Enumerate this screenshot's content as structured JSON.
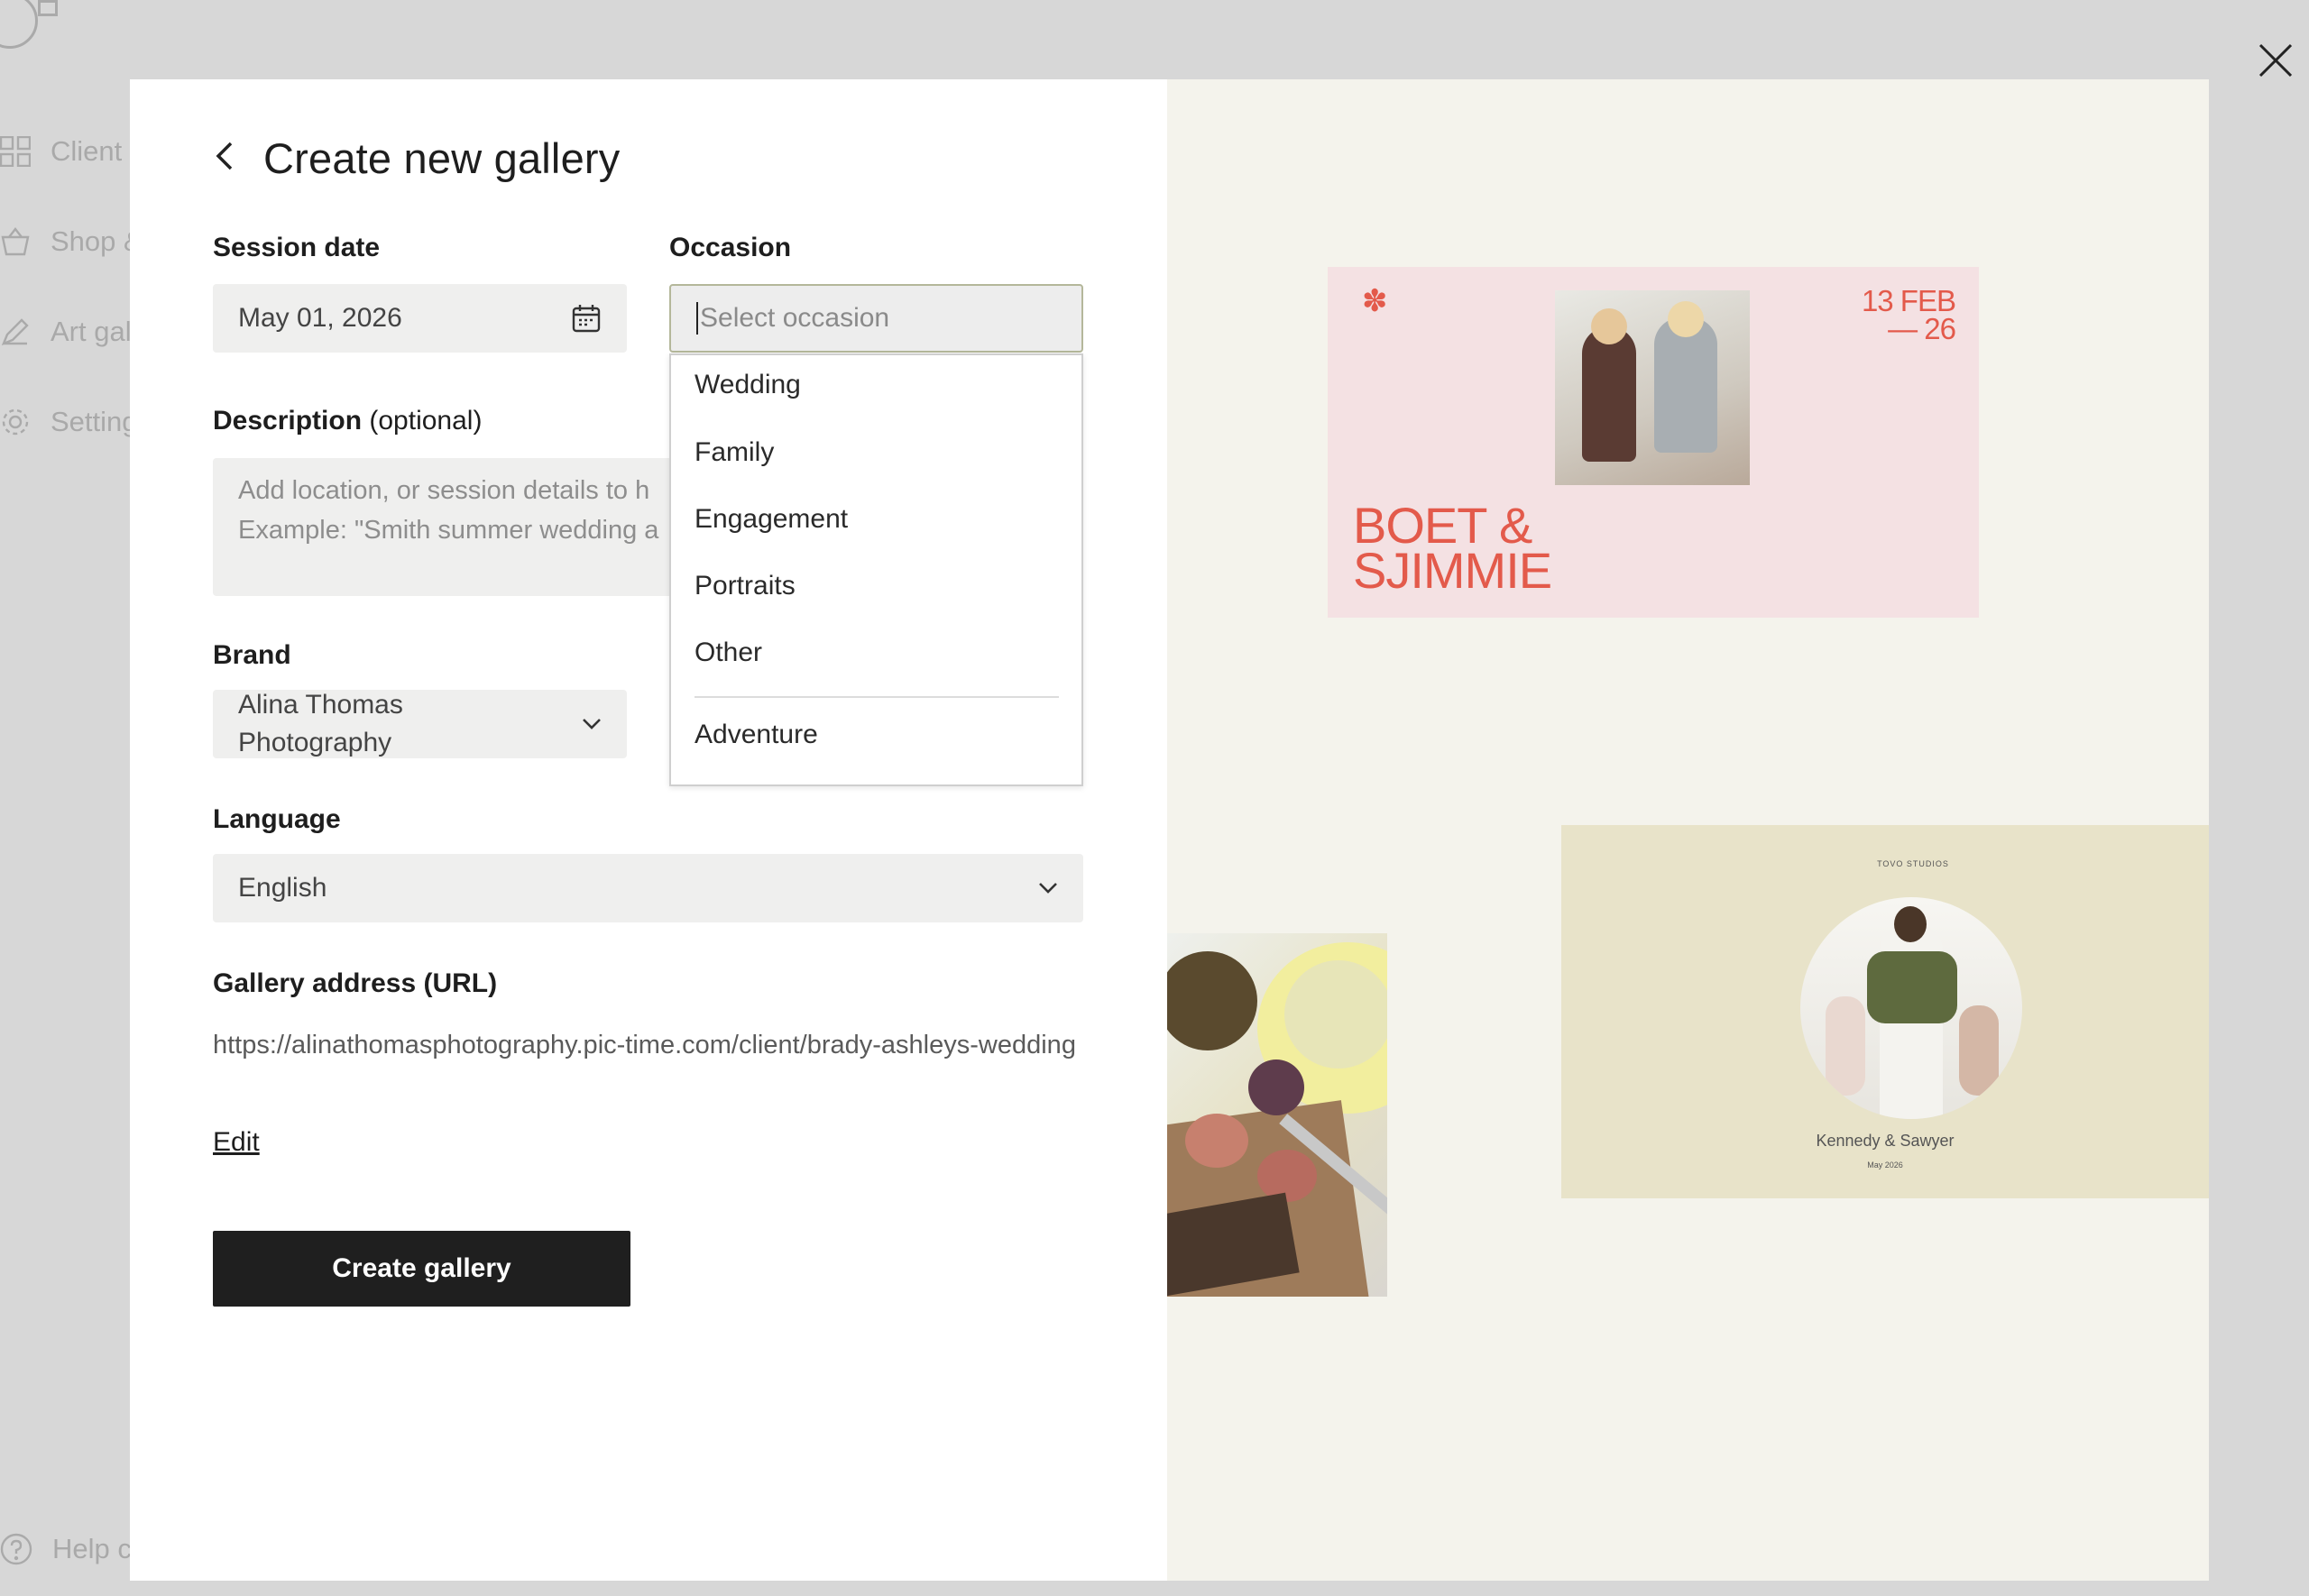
{
  "background": {
    "sidebar": {
      "items": [
        {
          "label": "Client",
          "icon": "grid-icon"
        },
        {
          "label": "Shop &",
          "icon": "basket-icon"
        },
        {
          "label": "Art gal",
          "icon": "pen-icon"
        },
        {
          "label": "Setting",
          "icon": "gear-icon"
        }
      ],
      "help_label": "Help c"
    }
  },
  "modal": {
    "title": "Create new gallery",
    "session_date": {
      "label": "Session date",
      "value": "May 01, 2026"
    },
    "occasion": {
      "label": "Occasion",
      "placeholder": "Select occasion",
      "options": [
        "Wedding",
        "Family",
        "Engagement",
        "Portraits",
        "Other"
      ],
      "extra_options": [
        "Adventure"
      ]
    },
    "description": {
      "label": "Description",
      "optional": "(optional)",
      "placeholder_line1": "Add location, or session details to h",
      "placeholder_line2": "Example: \"Smith summer wedding a"
    },
    "brand": {
      "label": "Brand",
      "value_line1": "Alina Thomas",
      "value_line2": "Photography"
    },
    "language": {
      "label": "Language",
      "value": "English"
    },
    "gallery_address": {
      "label": "Gallery address (URL)",
      "url": "https://alinathomasphotography.pic-time.com/client/brady-ashleys-wedding",
      "edit_label": "Edit"
    },
    "create_button": "Create gallery"
  },
  "preview": {
    "card1": {
      "date_line1": "13 FEB",
      "date_line2": "— 26",
      "names_line1": "BOET &",
      "names_line2": "SJIMMIE",
      "accent": "#e35a4b"
    },
    "card3": {
      "studio": "TOVO STUDIOS",
      "names": "Kennedy & Sawyer",
      "date": "May 2026"
    }
  },
  "colors": {
    "primary_button": "#1f1f1f",
    "field_bg": "#efefee",
    "preview_bg": "#f4f3ec"
  }
}
